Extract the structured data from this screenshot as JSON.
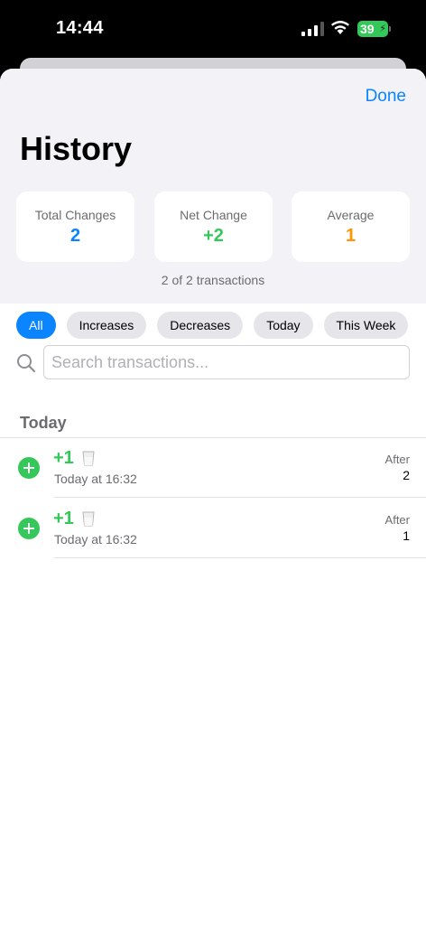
{
  "status_bar": {
    "time": "14:44",
    "battery": "39"
  },
  "sheet": {
    "done_label": "Done",
    "title": "History",
    "stats": [
      {
        "label": "Total Changes",
        "value": "2",
        "color": "#0a84ff"
      },
      {
        "label": "Net Change",
        "value": "+2",
        "color": "#34c759"
      },
      {
        "label": "Average",
        "value": "1",
        "color": "#ff9500"
      }
    ],
    "transaction_count": "2 of 2 transactions",
    "filters": [
      {
        "label": "All",
        "selected": true
      },
      {
        "label": "Increases",
        "selected": false
      },
      {
        "label": "Decreases",
        "selected": false
      },
      {
        "label": "Today",
        "selected": false
      },
      {
        "label": "This Week",
        "selected": false
      }
    ],
    "search": {
      "placeholder": "Search transactions...",
      "value": ""
    },
    "sections": [
      {
        "header": "Today",
        "transactions": [
          {
            "amount": "+1",
            "icon": "glass-icon",
            "time": "Today at 16:32",
            "after_label": "After",
            "after_value": "2"
          },
          {
            "amount": "+1",
            "icon": "glass-icon",
            "time": "Today at 16:32",
            "after_label": "After",
            "after_value": "1"
          }
        ]
      }
    ]
  },
  "colors": {
    "accent": "#0a84ff",
    "positive": "#34c759",
    "average": "#ff9500"
  }
}
